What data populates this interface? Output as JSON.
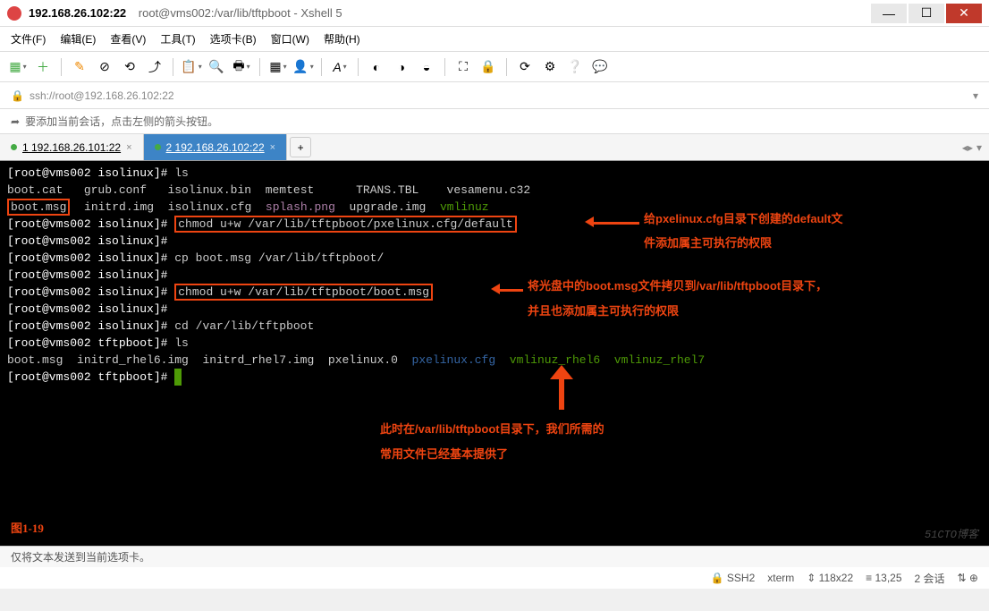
{
  "titlebar": {
    "host": "192.168.26.102:22",
    "subtitle": "root@vms002:/var/lib/tftpboot - Xshell 5"
  },
  "menu": {
    "file": "文件(F)",
    "edit": "编辑(E)",
    "view": "查看(V)",
    "tools": "工具(T)",
    "tab": "选项卡(B)",
    "window": "窗口(W)",
    "help": "帮助(H)"
  },
  "addressbar": {
    "url": "ssh://root@192.168.26.102:22"
  },
  "infobar": {
    "text": "要添加当前会话，点击左侧的箭头按钮。"
  },
  "tabs": {
    "t1": "1 192.168.26.101:22",
    "t2": "2 192.168.26.102:22"
  },
  "terminal": {
    "p_iso": "[root@vms002 isolinux]#",
    "p_tft": "[root@vms002 tftpboot]#",
    "ls": "ls",
    "row1": {
      "a": "boot.cat",
      "b": "grub.conf",
      "c": "isolinux.bin",
      "d": "memtest",
      "e": "TRANS.TBL",
      "f": "vesamenu.c32"
    },
    "row2": {
      "a": "boot.msg",
      "b": "initrd.img",
      "c": "isolinux.cfg",
      "d": "splash.png",
      "e": "upgrade.img",
      "f": "vmlinuz"
    },
    "cmd1": "chmod u+w /var/lib/tftpboot/pxelinux.cfg/default",
    "cmd2": "cp boot.msg /var/lib/tftpboot/",
    "cmd3": "chmod u+w /var/lib/tftpboot/boot.msg",
    "cmd4": "cd /var/lib/tftpboot",
    "ls2": {
      "a": "boot.msg",
      "b": "initrd_rhel6.img",
      "c": "initrd_rhel7.img",
      "d": "pxelinux.0",
      "e": "pxelinux.cfg",
      "f": "vmlinuz_rhel6",
      "g": "vmlinuz_rhel7"
    },
    "ann1a": "给pxelinux.cfg目录下创建的default文",
    "ann1b": "件添加属主可执行的权限",
    "ann2a": "将光盘中的boot.msg文件拷贝到/var/lib/tftpboot目录下，",
    "ann2b": "并且也添加属主可执行的权限",
    "ann3a": "此时在/var/lib/tftpboot目录下，我们所需的",
    "ann3b": "常用文件已经基本提供了",
    "figure": "图1-19",
    "watermark": "51CTO博客"
  },
  "status": {
    "left": "仅将文本发送到当前选项卡。",
    "ssh": "SSH2",
    "term": "xterm",
    "size": "118x22",
    "pos": "13,25",
    "sessions": "2 会话",
    "net": "↑↓"
  }
}
